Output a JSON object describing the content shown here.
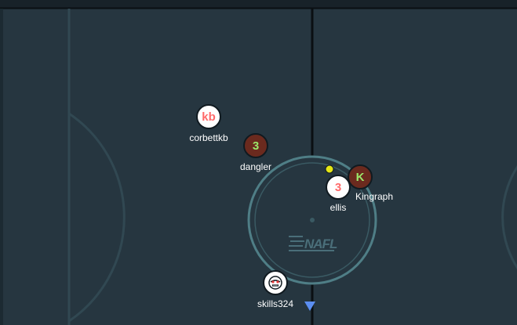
{
  "rink": {
    "background": "#263640",
    "line_color": "#314852",
    "center_line_color": "#0a0f12",
    "center_circle_color": "#4f7e86",
    "logo_text": "NAFL",
    "logo_color": "#4a6e79"
  },
  "players": [
    {
      "id": "corbettkb",
      "token": "kb",
      "name": "corbettkb",
      "style": "light"
    },
    {
      "id": "dangler",
      "token": "3",
      "name": "dangler",
      "style": "dark"
    },
    {
      "id": "kingraph",
      "token": "K",
      "name": "Kingraph",
      "style": "dark"
    },
    {
      "id": "ellis",
      "token": "3",
      "name": "ellis",
      "style": "light"
    },
    {
      "id": "skills324",
      "token": "",
      "icon": "masked-face-icon",
      "name": "skills324",
      "style": "light"
    }
  ],
  "puck": {
    "color": "#e5e615"
  },
  "marker": {
    "icon": "triangle-down-icon",
    "color": "#5b8ef0"
  }
}
